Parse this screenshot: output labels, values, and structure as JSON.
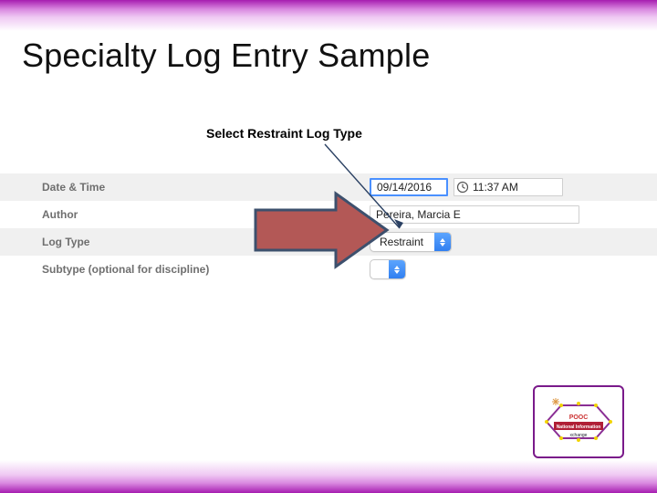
{
  "title": "Specialty Log Entry Sample",
  "instruction": "Select Restraint Log Type",
  "form": {
    "rows": {
      "datetime": {
        "label": "Date & Time",
        "date": "09/14/2016",
        "time": "11:37 AM"
      },
      "author": {
        "label": "Author",
        "value": "Pereira, Marcia E"
      },
      "logtype": {
        "label": "Log Type",
        "value": "Restraint"
      },
      "subtype": {
        "label": "Subtype (optional for discipline)",
        "value": ""
      }
    }
  },
  "logo": {
    "line1": "POOC",
    "line2": "National Information",
    "line3": "xchange"
  },
  "colors": {
    "accent_purple": "#a61db0",
    "arrow_fill": "#b35856",
    "arrow_stroke": "#3d506d",
    "select_blue": "#2f7df0"
  }
}
